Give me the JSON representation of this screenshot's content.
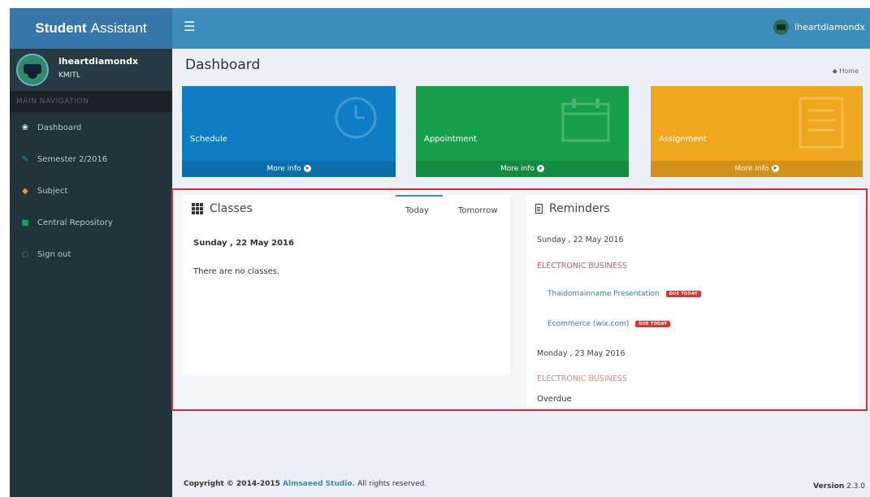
{
  "app": {
    "logo_bold": "Student",
    "logo_rest": "Assistant"
  },
  "header": {
    "menu_icon": "☰",
    "username": "iheartdiamondx"
  },
  "sidebar": {
    "user": {
      "name": "iheartdiamondx",
      "org": "KMITL"
    },
    "section_label": "MAIN NAVIGATION",
    "items": [
      {
        "label": "Dashboard",
        "icon": "dashboard-icon",
        "icon_color": "#ffffff",
        "glyph": "❀"
      },
      {
        "label": "Semester 2/2016",
        "icon": "pencil-icon",
        "icon_color": "#3c8dbc",
        "glyph": "✎"
      },
      {
        "label": "Subject",
        "icon": "graduation-cap-icon",
        "icon_color": "#f39c12",
        "glyph": "◆"
      },
      {
        "label": "Central Repository",
        "icon": "database-icon",
        "icon_color": "#00a65a",
        "glyph": "■"
      },
      {
        "label": "Sign out",
        "icon": "circle-icon",
        "icon_color": "#3c8dbc",
        "glyph": "○"
      }
    ]
  },
  "page": {
    "title": "Dashboard",
    "breadcrumb": "Home"
  },
  "tiles": [
    {
      "label": "Schedule",
      "footer": "More info",
      "icon": "clock-icon",
      "color": "#0d7ec4"
    },
    {
      "label": "Appointment",
      "footer": "More info",
      "icon": "calendar-icon",
      "color": "#17a049"
    },
    {
      "label": "Assignment",
      "footer": "More info",
      "icon": "list-icon",
      "color": "#f0a71d"
    }
  ],
  "classes": {
    "title": "Classes",
    "tabs": [
      "Today",
      "Tomorrow"
    ],
    "active_tab": "Today",
    "date": "Sunday , 22 May 2016",
    "message": "There are no classes."
  },
  "reminders": {
    "title": "Reminders",
    "date1": "Sunday , 22 May 2016",
    "subject1": "ELECTRONIC BUSINESS",
    "items": [
      {
        "label": "Thaidomainname Presentation",
        "badge": "DUE TODAY"
      },
      {
        "label": "Ecommerce (wix.com)",
        "badge": "DUE TODAY"
      }
    ],
    "date2": "Monday , 23 May 2016",
    "subject2": "ELECTRONIC BUSINESS",
    "overdue": "Overdue"
  },
  "footer": {
    "copyright_prefix": "Copyright © 2014-2015",
    "studio": "Almsaeed Studio.",
    "rights": "All rights reserved.",
    "version_label": "Version",
    "version": "2.3.0"
  }
}
